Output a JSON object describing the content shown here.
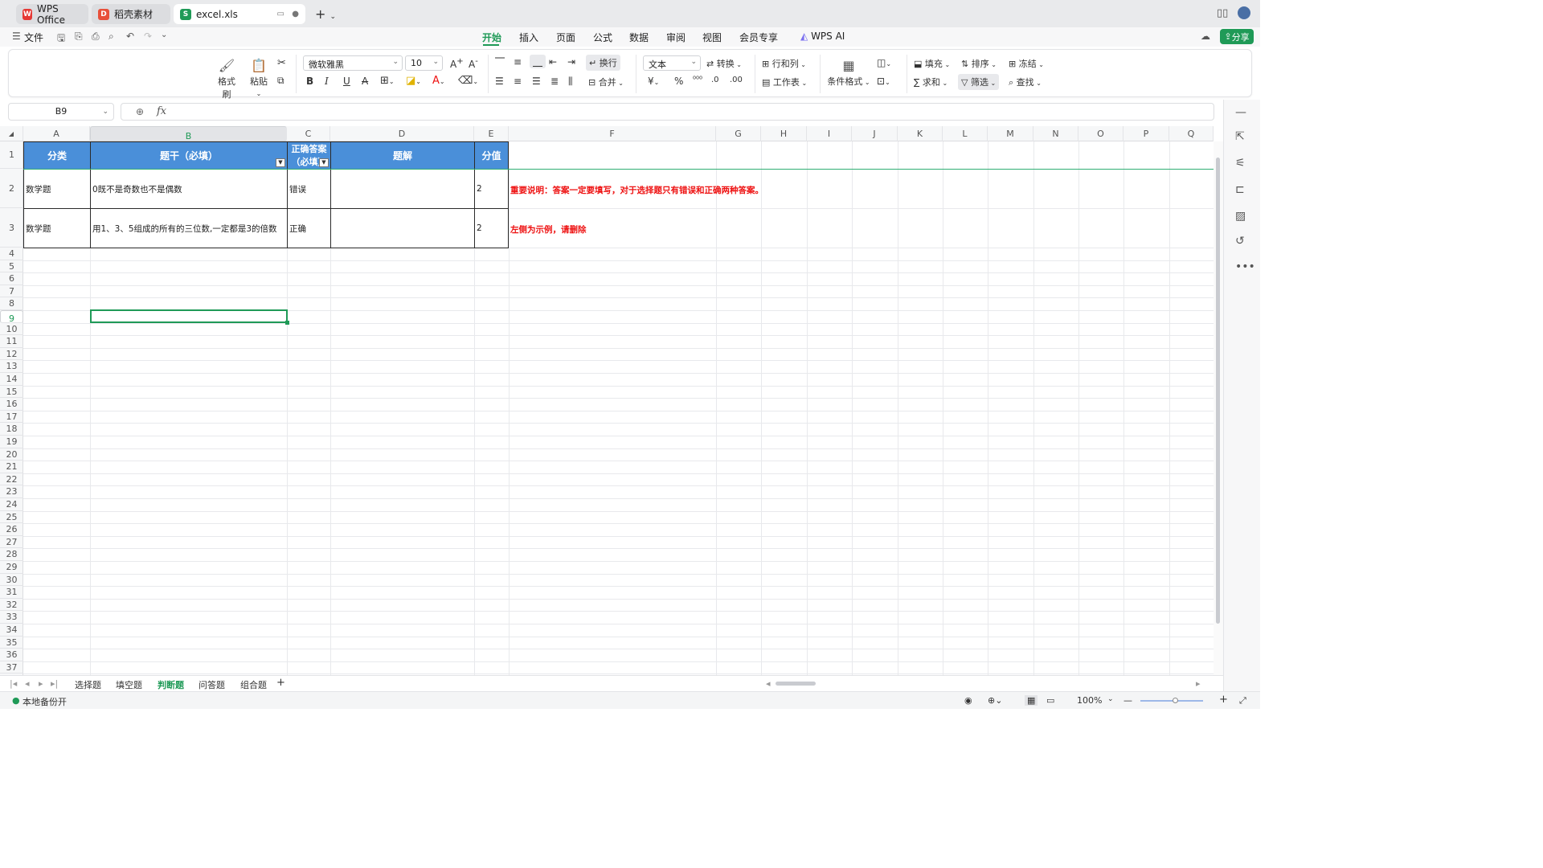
{
  "tabs": [
    {
      "label": "WPS Office",
      "logo": "W"
    },
    {
      "label": "稻壳素材",
      "logo": "D"
    },
    {
      "label": "excel.xls",
      "logo": "S"
    }
  ],
  "menu": {
    "file": "文件",
    "tabs": [
      "开始",
      "插入",
      "页面",
      "公式",
      "数据",
      "审阅",
      "视图",
      "会员专享"
    ],
    "active_tab": "开始",
    "ai": "WPS AI",
    "share": "分享"
  },
  "ribbon": {
    "format_painter": "格式刷",
    "paste": "粘贴",
    "font_name": "微软雅黑",
    "font_size": "10",
    "wrap": "换行",
    "merge": "合并",
    "number_format": "文本",
    "convert": "转换",
    "rows_cols": "行和列",
    "worksheet": "工作表",
    "cond_format": "条件格式",
    "fill": "填充",
    "sort": "排序",
    "freeze": "冻结",
    "sum": "求和",
    "filter": "筛选",
    "find": "查找"
  },
  "formula_bar": {
    "name_box": "B9",
    "fx": "fx"
  },
  "columns": [
    "A",
    "B",
    "C",
    "D",
    "E",
    "F",
    "G",
    "H",
    "I",
    "J",
    "K",
    "L",
    "M",
    "N",
    "O",
    "P",
    "Q"
  ],
  "rows": [
    "1",
    "2",
    "3",
    "4",
    "5",
    "6",
    "7",
    "8",
    "9",
    "10",
    "11",
    "12",
    "13",
    "14",
    "15",
    "16",
    "17",
    "18",
    "19",
    "20",
    "21",
    "22",
    "23",
    "24",
    "25",
    "26",
    "27",
    "28",
    "29",
    "30",
    "31",
    "32",
    "33",
    "34",
    "35",
    "36",
    "37"
  ],
  "table": {
    "headers": [
      "分类",
      "题干（必填）",
      "正确答案（必填）",
      "题解",
      "分值"
    ],
    "rows": [
      [
        "数学题",
        "0既不是奇数也不是偶数",
        "错误",
        "",
        "2"
      ],
      [
        "数学题",
        "用1、3、5组成的所有的三位数,一定都是3的倍数",
        "正确",
        "",
        "2"
      ]
    ]
  },
  "notes": [
    "重要说明：答案一定要填写，对于选择题只有错误和正确两种答案。",
    "左侧为示例，请删除"
  ],
  "sheets": [
    "选择题",
    "填空题",
    "判断题",
    "问答题",
    "组合题"
  ],
  "active_sheet": "判断题",
  "status": {
    "backup": "本地备份开",
    "zoom": "100%"
  },
  "colors": {
    "accent": "#1f9a57",
    "header_fill": "#4a8fd9",
    "note_red": "#e11111"
  }
}
